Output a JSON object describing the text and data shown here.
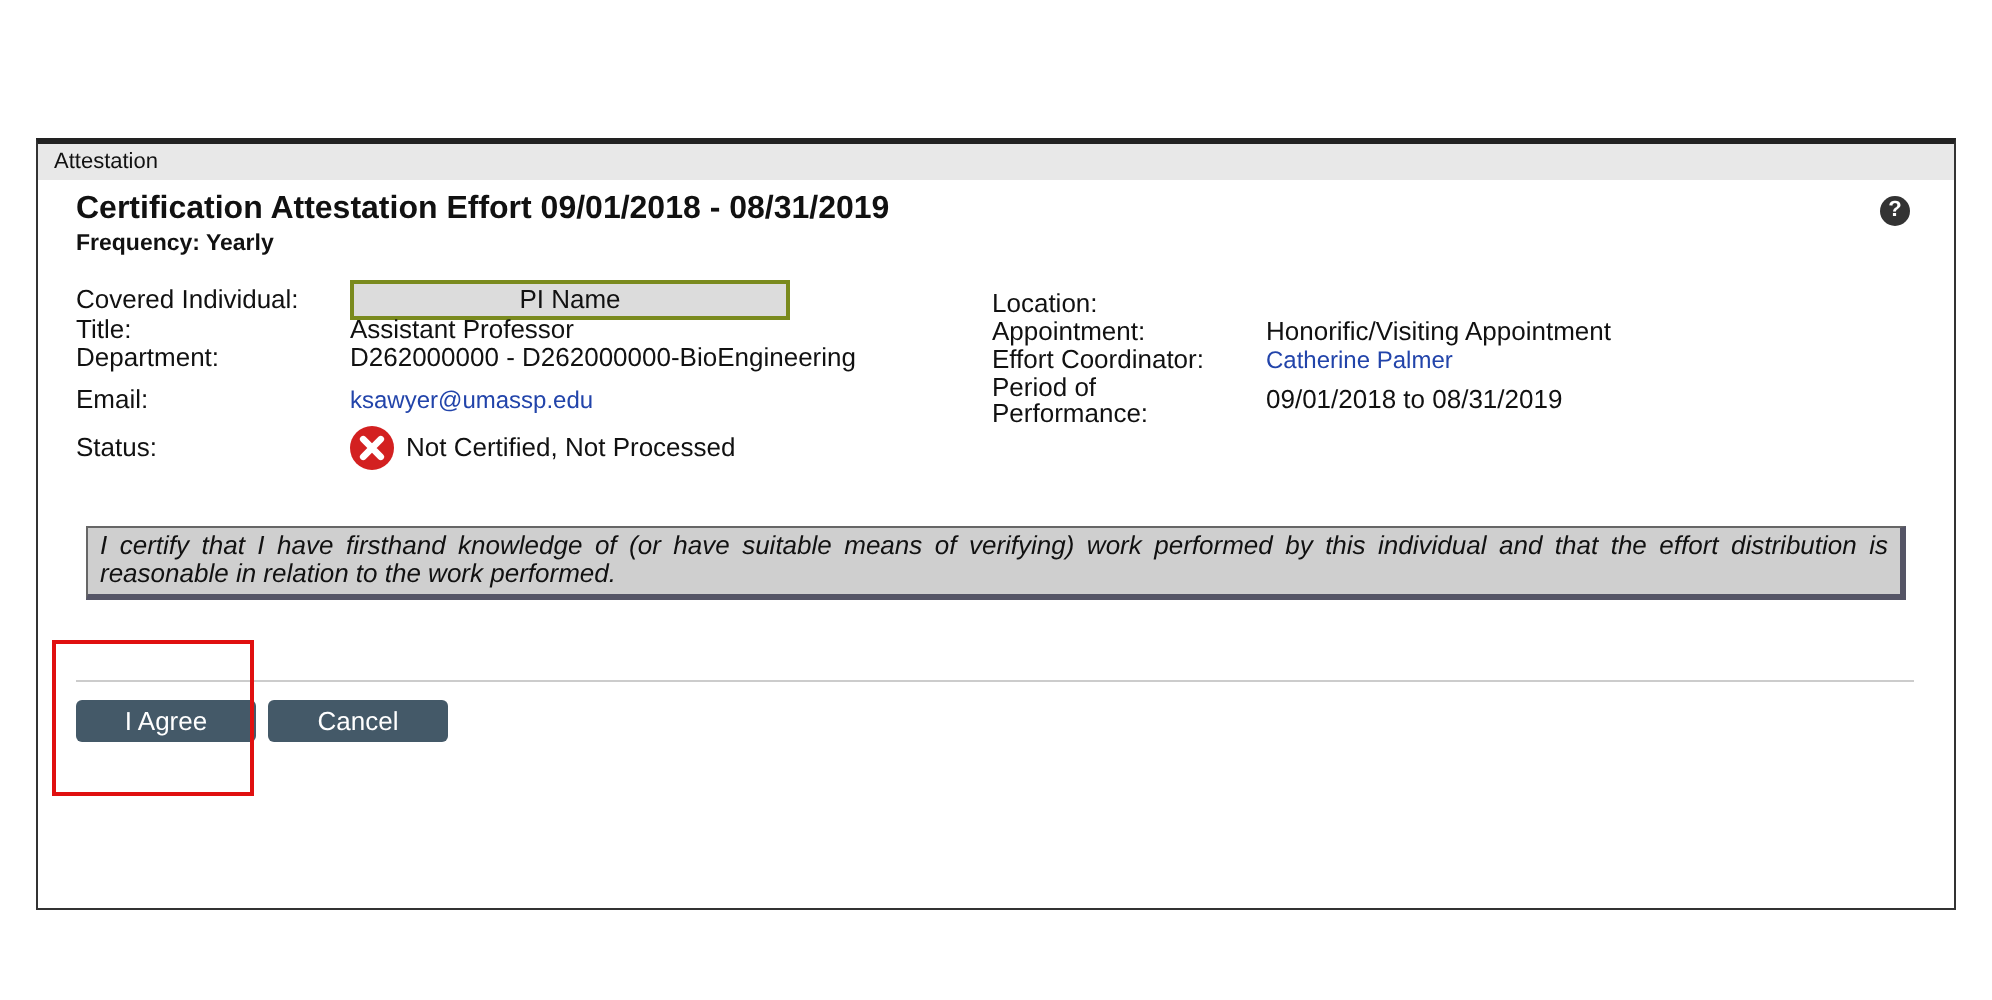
{
  "dialog": {
    "title": "Attestation"
  },
  "heading": "Certification Attestation Effort 09/01/2018 - 08/31/2019",
  "frequency": "Frequency: Yearly",
  "help": {
    "glyph": "?"
  },
  "left_fields": [
    {
      "label": "Covered Individual:",
      "value": "PI Name",
      "kind": "name-box"
    },
    {
      "label": "Title:",
      "value": "Assistant Professor",
      "kind": "text"
    },
    {
      "label": "Department:",
      "value": "D262000000 - D262000000-BioEngineering",
      "kind": "text"
    },
    {
      "label": "Email:",
      "value": "ksawyer@umassp.edu",
      "kind": "link"
    },
    {
      "label": "Status:",
      "value": "Not Certified, Not Processed",
      "kind": "status-error"
    }
  ],
  "right_fields": [
    {
      "label": "Location:"
    },
    {
      "label": "Appointment:",
      "value": "Honorific/Visiting Appointment",
      "kind": "text"
    },
    {
      "label": "Effort Coordinator:",
      "value": "Catherine Palmer",
      "kind": "link"
    },
    {
      "label": "Period of Performance:",
      "value": "09/01/2018 to 08/31/2019",
      "kind": "text"
    }
  ],
  "statement": "I certify that I have firsthand knowledge of (or have suitable means of verifying) work performed by this individual and that the effort distribution is reasonable in relation to the work performed.",
  "buttons": [
    {
      "label": "I Agree",
      "highlighted": true
    },
    {
      "label": "Cancel",
      "highlighted": false
    }
  ]
}
